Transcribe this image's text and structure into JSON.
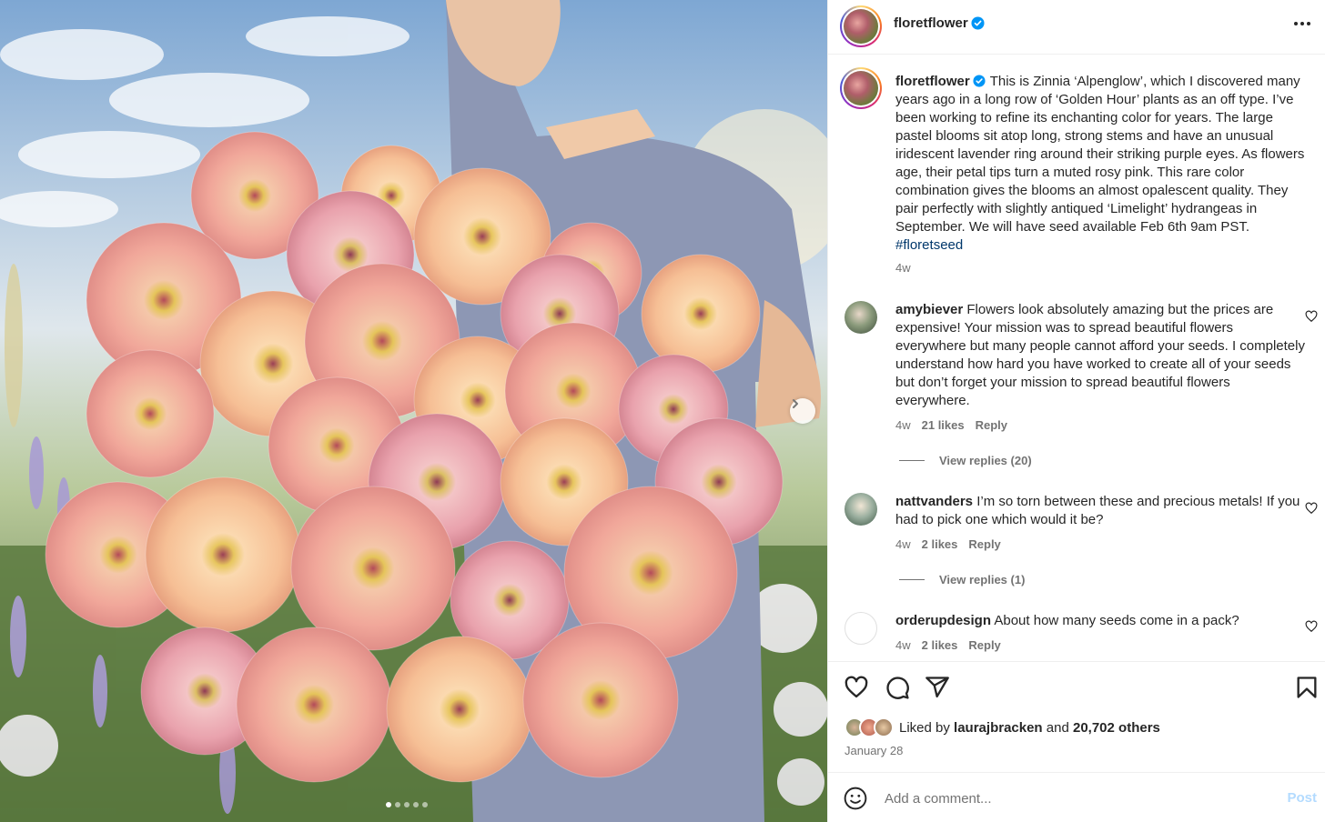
{
  "post": {
    "username": "floretflower",
    "caption": "This is Zinnia ‘Alpenglow’, which I discovered many years ago in a long row of ‘Golden Hour’ plants as an off type. I’ve been working to refine its enchanting color for years. The large pastel blooms sit atop long, strong stems and have an unusual iridescent lavender ring around their striking purple eyes. As flowers age, their petal tips turn a muted rosy pink. This rare color combination gives the blooms an almost opalescent quality. They pair perfectly with slightly antiqued ‘Limelight’ hydrangeas in September. We will have seed available Feb 6th 9am PST.",
    "hashtag": "#floretseed",
    "age": "4w"
  },
  "carousel": {
    "dots": 5,
    "active_index": 0
  },
  "comments": [
    {
      "username": "amybiever",
      "text": "Flowers look absolutely amazing but the prices are expensive! Your mission was to spread beautiful flowers everywhere but many people cannot afford your seeds. I completely understand how hard you have worked to create all of your seeds but don’t forget your mission to spread beautiful flowers everywhere.",
      "age": "4w",
      "likes": "21 likes",
      "reply": "Reply",
      "view_replies": "View replies (20)"
    },
    {
      "username": "nattvanders",
      "text": "I’m so torn between these and precious metals! If you had to pick one which would it be?",
      "age": "4w",
      "likes": "2 likes",
      "reply": "Reply",
      "view_replies": "View replies (1)"
    },
    {
      "username": "orderupdesign",
      "text": "About how many seeds come in a pack?",
      "age": "4w",
      "likes": "2 likes",
      "reply": "Reply"
    }
  ],
  "likes": {
    "prefix": "Liked by",
    "liker": "laurajbracken",
    "conjunction": "and",
    "others": "20,702 others"
  },
  "date": "January 28",
  "comment_box": {
    "placeholder": "Add a comment...",
    "post_label": "Post"
  },
  "colors": {
    "verified": "#0095f6",
    "link": "#00376b",
    "muted": "#737373",
    "post_disabled": "#b3dbff"
  },
  "icons": [
    "verified-icon",
    "more-icon",
    "heart-icon",
    "comment-icon",
    "share-icon",
    "bookmark-icon",
    "emoji-icon",
    "chevron-right-icon"
  ]
}
